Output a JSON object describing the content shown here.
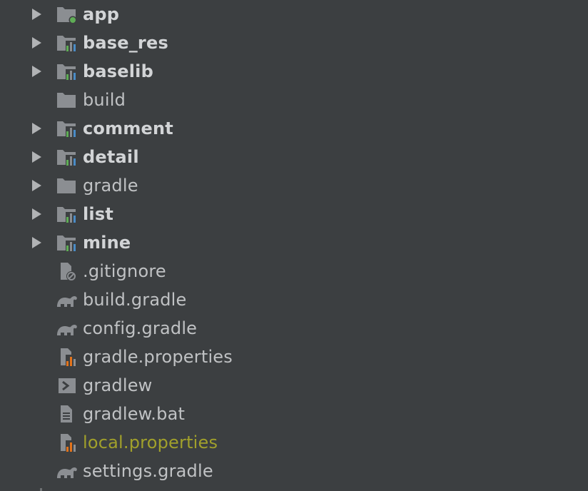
{
  "colors": {
    "background": "#3c3f41",
    "text": "#c0c2c4",
    "text_bold": "#d2d4d6",
    "modified_text": "#a1a02b",
    "arrow": "#b1b3b5",
    "folder_gray": "#8b8e92",
    "module_green": "#5fad56",
    "module_blue": "#4a8cc7",
    "bar_orange": "#e2731b"
  },
  "project_tree": {
    "items": [
      {
        "label": "app",
        "icon": "module-folder-icon",
        "expandable": true,
        "bold": true
      },
      {
        "label": "base_res",
        "icon": "module-folder-icon",
        "expandable": true,
        "bold": true
      },
      {
        "label": "baselib",
        "icon": "module-folder-icon",
        "expandable": true,
        "bold": true
      },
      {
        "label": "build",
        "icon": "folder-icon",
        "expandable": false,
        "bold": false
      },
      {
        "label": "comment",
        "icon": "module-folder-icon",
        "expandable": true,
        "bold": true
      },
      {
        "label": "detail",
        "icon": "module-folder-icon",
        "expandable": true,
        "bold": true
      },
      {
        "label": "gradle",
        "icon": "folder-icon",
        "expandable": true,
        "bold": false
      },
      {
        "label": "list",
        "icon": "module-folder-icon",
        "expandable": true,
        "bold": true
      },
      {
        "label": "mine",
        "icon": "module-folder-icon",
        "expandable": true,
        "bold": true
      },
      {
        "label": ".gitignore",
        "icon": "ignore-file-icon",
        "expandable": false,
        "bold": false
      },
      {
        "label": "build.gradle",
        "icon": "gradle-elephant-icon",
        "expandable": false,
        "bold": false
      },
      {
        "label": "config.gradle",
        "icon": "gradle-elephant-icon",
        "expandable": false,
        "bold": false
      },
      {
        "label": "gradle.properties",
        "icon": "properties-file-icon",
        "expandable": false,
        "bold": false
      },
      {
        "label": "gradlew",
        "icon": "shell-script-icon",
        "expandable": false,
        "bold": false
      },
      {
        "label": "gradlew.bat",
        "icon": "text-file-icon",
        "expandable": false,
        "bold": false
      },
      {
        "label": "local.properties",
        "icon": "properties-file-icon",
        "expandable": false,
        "bold": false,
        "modified": true
      },
      {
        "label": "settings.gradle",
        "icon": "gradle-elephant-icon",
        "expandable": false,
        "bold": false
      }
    ]
  }
}
